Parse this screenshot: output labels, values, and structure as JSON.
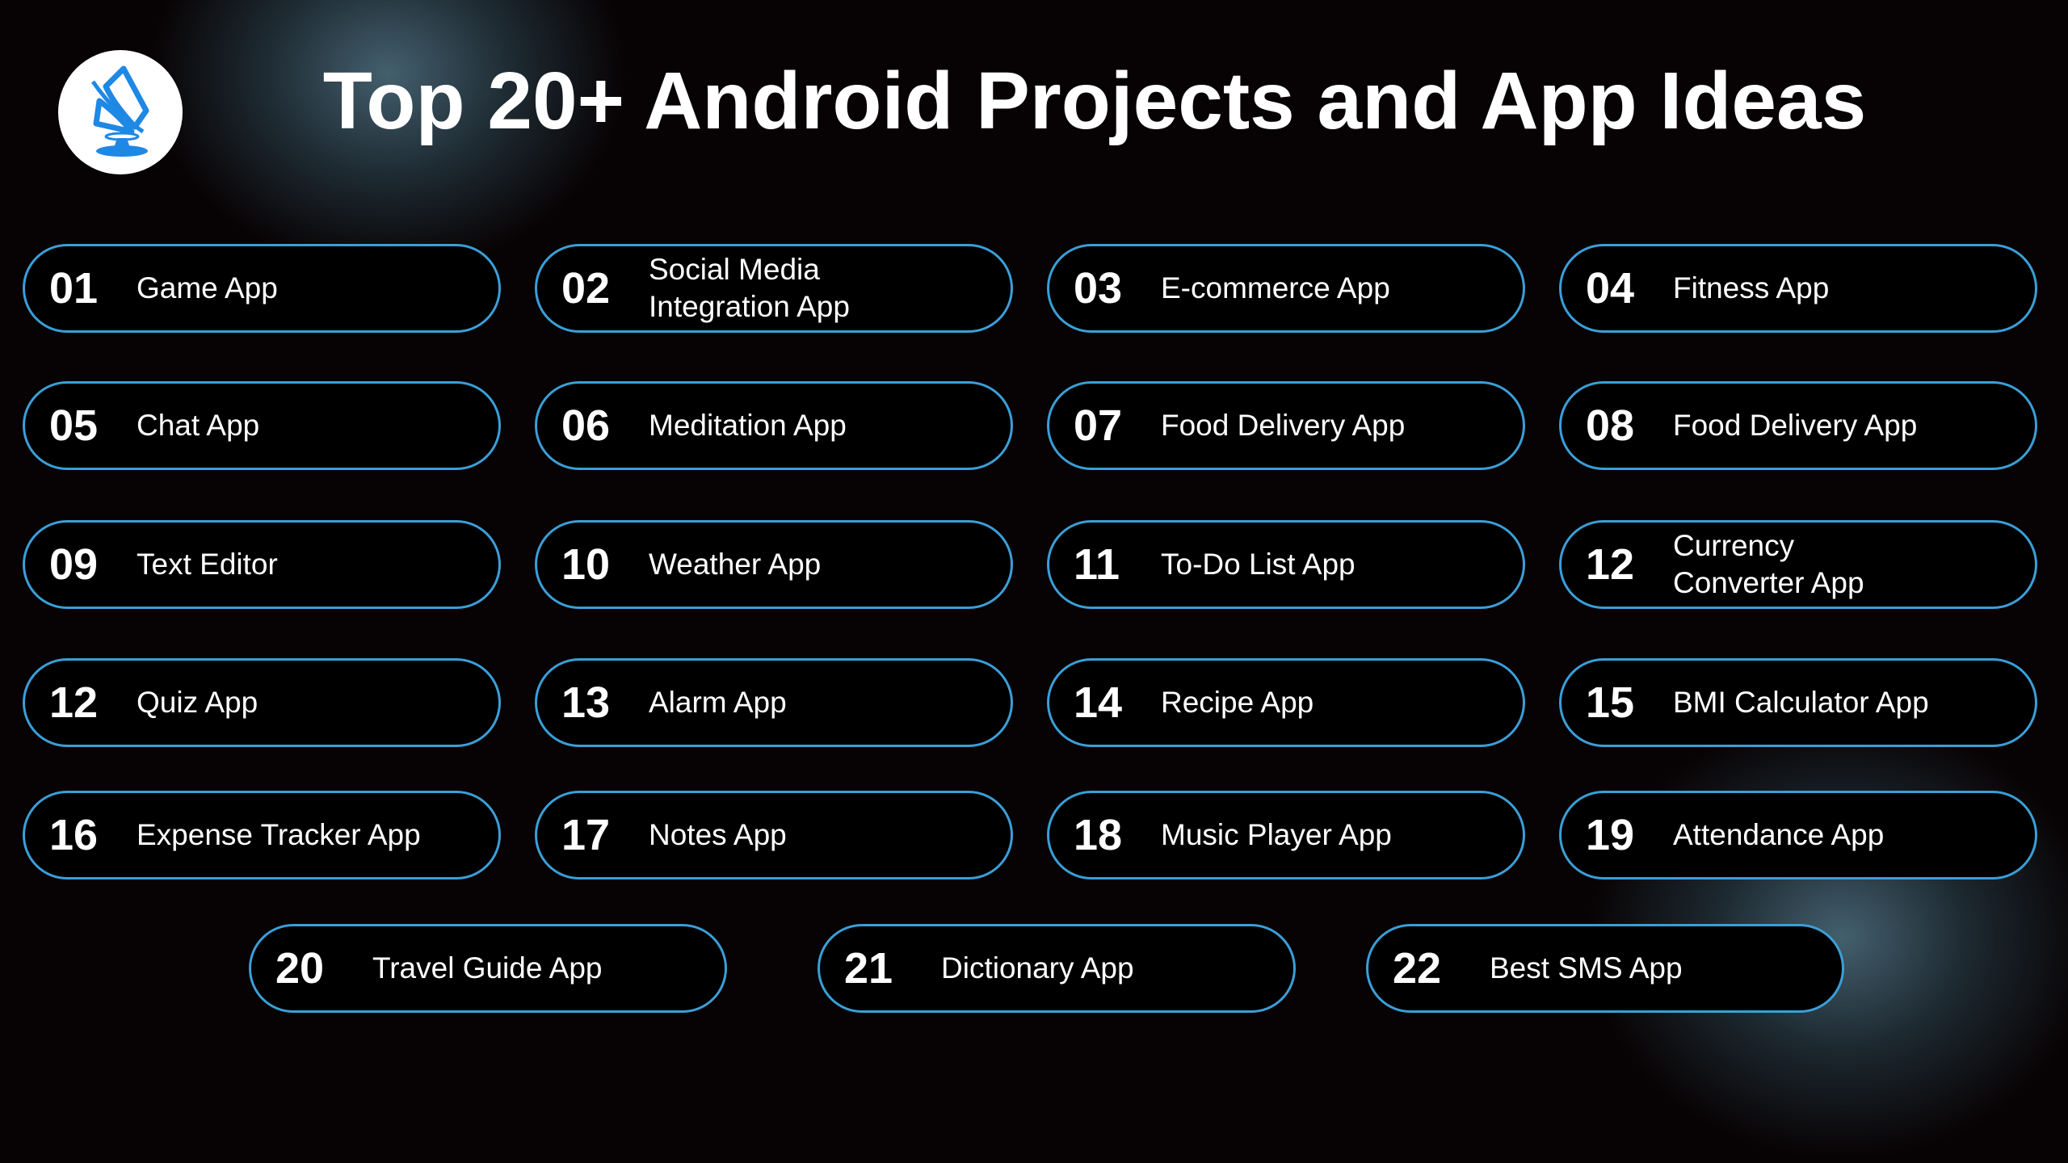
{
  "title": "Top 20+ Android Projects and App Ideas",
  "logo": {
    "icon": "rocket-sail-logo",
    "color": "#1e88e5"
  },
  "colors": {
    "accent_border": "#3a9fd8",
    "background": "#070203",
    "glow": "#4e7080"
  },
  "items": [
    {
      "num": "01",
      "label": "Game App"
    },
    {
      "num": "02",
      "label": "Social Media Integration App"
    },
    {
      "num": "03",
      "label": "E-commerce App"
    },
    {
      "num": "04",
      "label": "Fitness App"
    },
    {
      "num": "05",
      "label": "Chat App"
    },
    {
      "num": "06",
      "label": "Meditation App"
    },
    {
      "num": "07",
      "label": "Food Delivery App"
    },
    {
      "num": "08",
      "label": "Food Delivery App"
    },
    {
      "num": "09",
      "label": "Text Editor"
    },
    {
      "num": "10",
      "label": "Weather App"
    },
    {
      "num": "11",
      "label": "To-Do List App"
    },
    {
      "num": "12",
      "label": "Currency Converter App"
    },
    {
      "num": "12",
      "label": "Quiz App"
    },
    {
      "num": "13",
      "label": "Alarm App"
    },
    {
      "num": "14",
      "label": "Recipe App"
    },
    {
      "num": "15",
      "label": "BMI Calculator App"
    },
    {
      "num": "16",
      "label": "Expense Tracker App"
    },
    {
      "num": "17",
      "label": "Notes App"
    },
    {
      "num": "18",
      "label": "Music Player App"
    },
    {
      "num": "19",
      "label": "Attendance App"
    },
    {
      "num": "20",
      "label": "Travel Guide App"
    },
    {
      "num": "21",
      "label": "Dictionary App"
    },
    {
      "num": "22",
      "label": "Best SMS App"
    }
  ]
}
